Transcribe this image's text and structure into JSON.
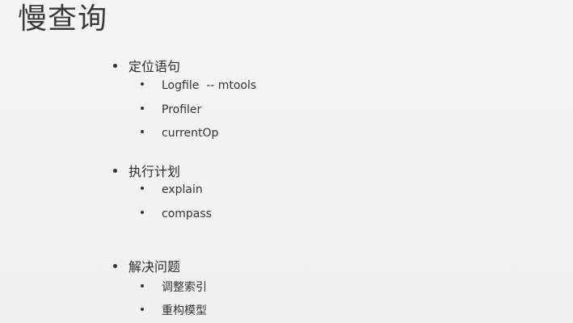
{
  "slide": {
    "title": "慢查询",
    "sections": [
      {
        "heading": "定位语句",
        "items": [
          "Logfile  -- mtools",
          "Profiler",
          "currentOp"
        ]
      },
      {
        "heading": "执行计划",
        "items": [
          "explain",
          "compass"
        ]
      },
      {
        "heading": "解决问题",
        "items": [
          "调整索引",
          "重构模型"
        ]
      }
    ]
  }
}
